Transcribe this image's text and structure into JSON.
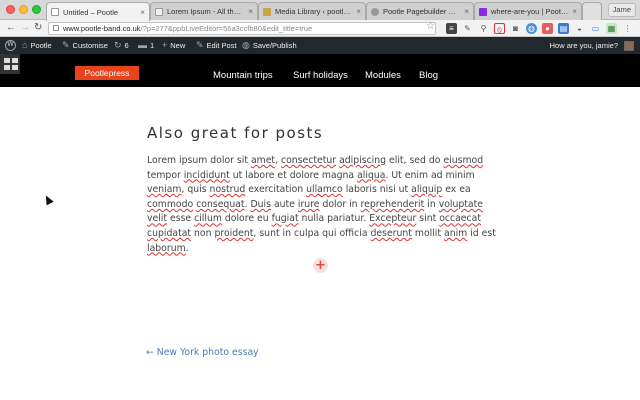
{
  "browser": {
    "tabs": [
      {
        "title": "Untitled – Pootle",
        "active": true,
        "favicon_color": "#ffffff"
      },
      {
        "title": "Lorem Ipsum - All the facts",
        "active": false,
        "favicon_color": "#eeeeee"
      },
      {
        "title": "Media Library ‹ pootlepress",
        "active": false,
        "favicon_color": "#c9a24a"
      },
      {
        "title": "Pootle Pagebuilder — Word",
        "active": false,
        "favicon_color": "#999999"
      },
      {
        "title": "where-are-you | PootlePress",
        "active": false,
        "favicon_color": "#8a2be2"
      }
    ],
    "new_tab_label": "",
    "user_chip": "Jame",
    "url_host": "www.pootle-band.co.uk",
    "url_path": "/?p=277&ppbLiveEditor=56a3ccfb80&edit_title=true"
  },
  "admin_bar": {
    "site_name": "Pootle",
    "customise": "Customise",
    "updates_count": "6",
    "comments_count": "1",
    "new_label": "New",
    "edit_post": "Edit Post",
    "save_publish": "Save/Publish",
    "greeting": "How are you, jamie?"
  },
  "site": {
    "brand": "Pootlepress",
    "brand_color": "#e8431c",
    "menu": [
      "Mountain trips",
      "Surf holidays",
      "Modules",
      "Blog"
    ]
  },
  "post": {
    "title": "Also great for posts",
    "body_parts": [
      "Lorem ipsum dolor sit ",
      "amet",
      ", ",
      "consectetur",
      " ",
      "adipiscing",
      " elit, sed do ",
      "eiusmod",
      " tempor ",
      "incididunt",
      " ut labore et dolore magna ",
      "aliqua",
      ". Ut enim ad minim ",
      "veniam",
      ", quis ",
      "nostrud",
      " exercitation ",
      "ullamco",
      " laboris nisi ut ",
      "aliquip",
      " ex ea ",
      "commodo",
      " ",
      "consequat",
      ". ",
      "Duis",
      " aute ",
      "irure",
      " dolor in ",
      "reprehenderit",
      " in ",
      "voluptate",
      " ",
      "velit",
      " esse ",
      "cillum",
      " dolore eu ",
      "fugiat",
      " nulla pariatur. ",
      "Excepteur",
      " sint ",
      "occaecat",
      " ",
      "cupidatat",
      " non ",
      "proident",
      ", sunt in culpa qui officia ",
      "deserunt",
      " mollit ",
      "anim",
      " id est ",
      "laborum",
      "."
    ],
    "add_module_symbol": "+",
    "previous_link": "← New York photo essay"
  }
}
